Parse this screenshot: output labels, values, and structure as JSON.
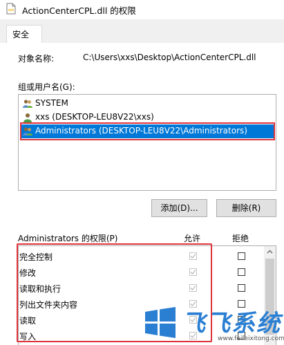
{
  "window": {
    "title": "ActionCenterCPL.dll 的权限"
  },
  "tabs": [
    {
      "label": "安全"
    }
  ],
  "object": {
    "label": "对象名称:",
    "value": "C:\\Users\\xxs\\Desktop\\ActionCenterCPL.dll"
  },
  "groups": {
    "label": "组或用户名(G):",
    "items": [
      {
        "label": "SYSTEM",
        "icon": "user-group-icon"
      },
      {
        "label": "xxs (DESKTOP-LEU8V22\\xxs)",
        "icon": "user-icon"
      },
      {
        "label": "Administrators (DESKTOP-LEU8V22\\Administrators)",
        "icon": "user-group-icon",
        "selected": true
      }
    ]
  },
  "buttons": {
    "add": "添加(D)...",
    "remove": "删除(R)"
  },
  "permissions": {
    "label": "Administrators 的权限(P)",
    "allow_header": "允许",
    "deny_header": "拒绝",
    "items": [
      {
        "label": "完全控制",
        "allow": true,
        "deny": false
      },
      {
        "label": "修改",
        "allow": true,
        "deny": false
      },
      {
        "label": "读取和执行",
        "allow": true,
        "deny": false
      },
      {
        "label": "列出文件夹内容",
        "allow": true,
        "deny": false
      },
      {
        "label": "读取",
        "allow": true,
        "deny": false
      },
      {
        "label": "写入",
        "allow": true,
        "deny": false
      }
    ]
  },
  "watermark": {
    "text": "飞飞系统",
    "url": "www.feifeixitong.com"
  },
  "colors": {
    "selection": "#0078d7",
    "highlight_frame": "#e0313a",
    "watermark": "#2b7fd3"
  }
}
